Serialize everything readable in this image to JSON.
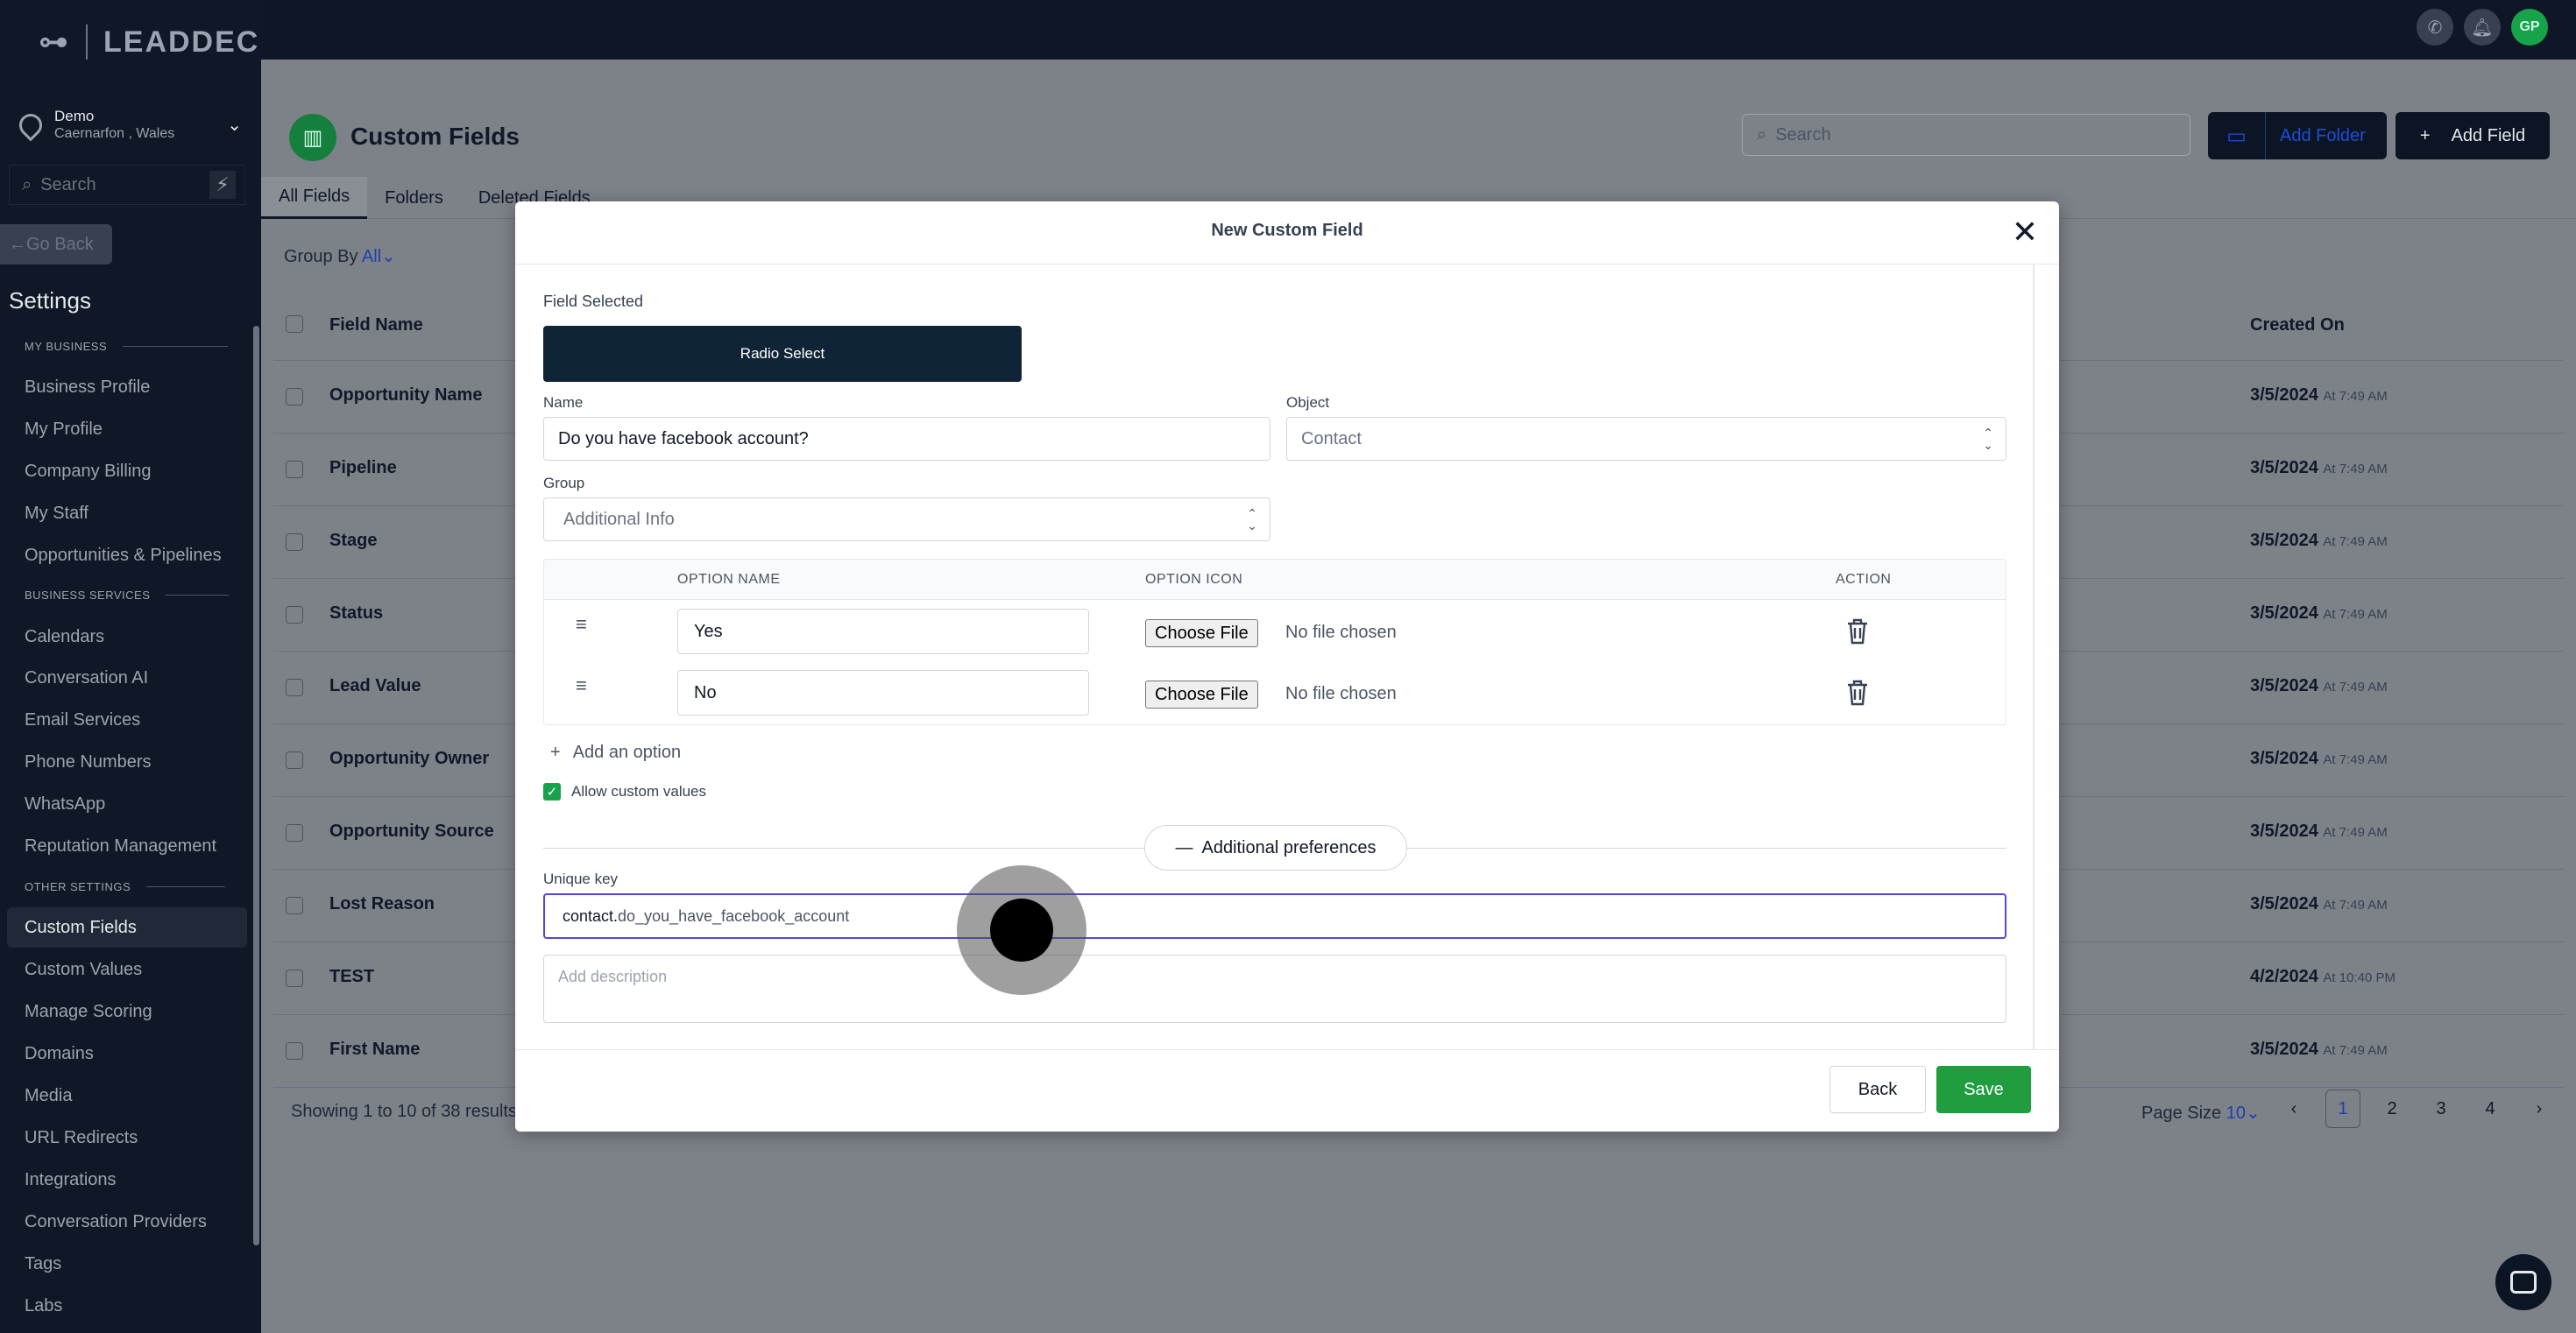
{
  "sidebar": {
    "logo": "LEADDEC",
    "location": {
      "name": "Demo",
      "address": "Caernarfon , Wales"
    },
    "search_placeholder": "Search",
    "go_back": "Go Back",
    "settings_title": "Settings",
    "sections": [
      {
        "label": "MY BUSINESS"
      },
      {
        "label": "BUSINESS SERVICES"
      },
      {
        "label": "OTHER SETTINGS"
      }
    ],
    "items": [
      "Business Profile",
      "My Profile",
      "Company Billing",
      "My Staff",
      "Opportunities & Pipelines",
      "Calendars",
      "Conversation AI",
      "Email Services",
      "Phone Numbers",
      "WhatsApp",
      "Reputation Management",
      "Custom Fields",
      "Custom Values",
      "Manage Scoring",
      "Domains",
      "Media",
      "URL Redirects",
      "Integrations",
      "Conversation Providers",
      "Tags",
      "Labs"
    ],
    "active_item": "Custom Fields"
  },
  "topbar": {
    "avatar_initials": "GP"
  },
  "page": {
    "title": "Custom Fields",
    "search_placeholder": "Search",
    "add_folder": "Add Folder",
    "add_field": "Add Field",
    "tabs": [
      "All Fields",
      "Folders",
      "Deleted Fields"
    ],
    "group_by_label": "Group By",
    "group_by_value": "All",
    "columns": {
      "name": "Field Name",
      "created": "Created On"
    },
    "rows": [
      {
        "name": "Opportunity Name",
        "date": "3/5/2024",
        "time": "At 7:49 AM"
      },
      {
        "name": "Pipeline",
        "date": "3/5/2024",
        "time": "At 7:49 AM"
      },
      {
        "name": "Stage",
        "date": "3/5/2024",
        "time": "At 7:49 AM"
      },
      {
        "name": "Status",
        "date": "3/5/2024",
        "time": "At 7:49 AM"
      },
      {
        "name": "Lead Value",
        "date": "3/5/2024",
        "time": "At 7:49 AM"
      },
      {
        "name": "Opportunity Owner",
        "date": "3/5/2024",
        "time": "At 7:49 AM"
      },
      {
        "name": "Opportunity Source",
        "date": "3/5/2024",
        "time": "At 7:49 AM"
      },
      {
        "name": "Lost Reason",
        "date": "3/5/2024",
        "time": "At 7:49 AM"
      },
      {
        "name": "TEST",
        "date": "4/2/2024",
        "time": "At 10:40 PM"
      },
      {
        "name": "First Name",
        "date": "3/5/2024",
        "time": "At 7:49 AM"
      }
    ],
    "showing": "Showing 1 to 10 of 38 results",
    "page_size_label": "Page Size",
    "page_size_value": "10",
    "pages": [
      "1",
      "2",
      "3",
      "4"
    ],
    "current_page": "1"
  },
  "modal": {
    "title": "New Custom Field",
    "field_selected_label": "Field Selected",
    "field_selected_value": "Radio Select",
    "name_label": "Name",
    "name_value": "Do you have facebook account?",
    "object_label": "Object",
    "object_value": "Contact",
    "group_label": "Group",
    "group_value": "Additional Info",
    "option_columns": {
      "name": "OPTION NAME",
      "icon": "OPTION ICON",
      "action": "ACTION"
    },
    "options": [
      {
        "name": "Yes",
        "file_button": "Choose File",
        "file_status": "No file chosen"
      },
      {
        "name": "No",
        "file_button": "Choose File",
        "file_status": "No file chosen"
      }
    ],
    "add_option": "Add an option",
    "allow_custom": "Allow custom values",
    "allow_custom_checked": true,
    "additional_prefs": "Additional preferences",
    "unique_key_label": "Unique key",
    "unique_key_prefix": "contact.",
    "unique_key_value": "do_you_have_facebook_account",
    "description_placeholder": "Add description",
    "back": "Back",
    "save": "Save"
  }
}
